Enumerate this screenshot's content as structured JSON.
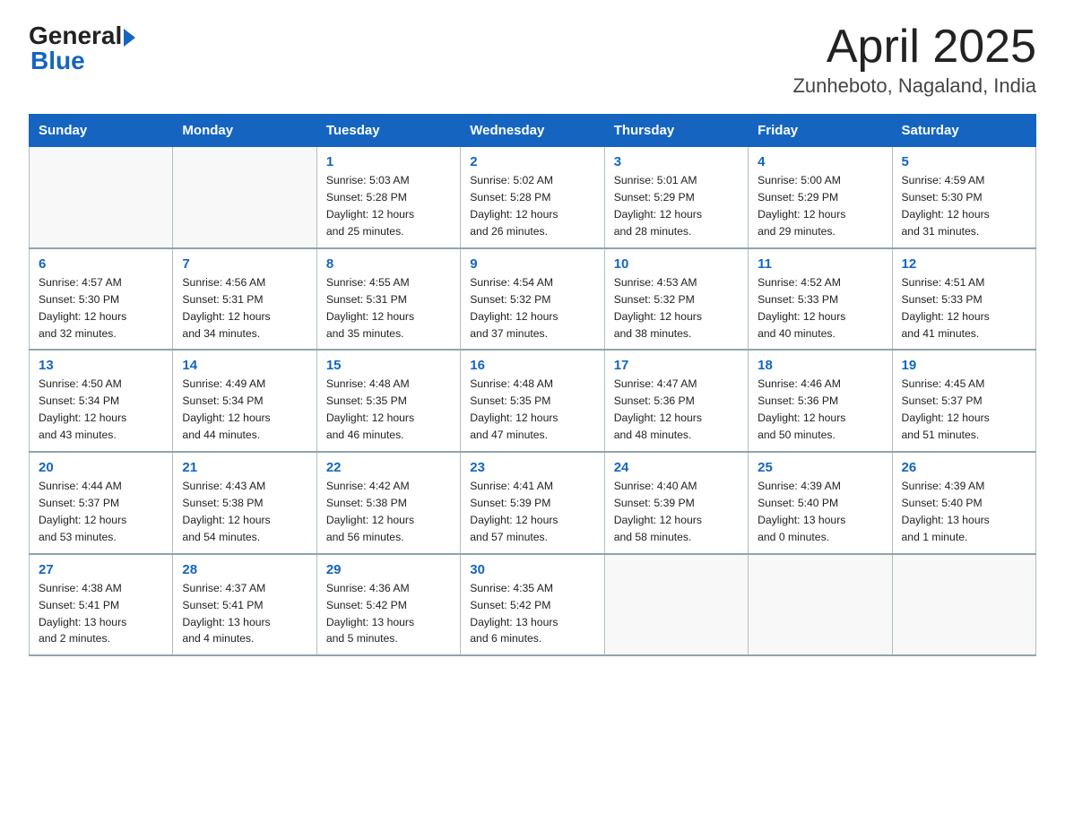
{
  "header": {
    "logo_general": "General",
    "logo_blue": "Blue",
    "month": "April 2025",
    "location": "Zunheboto, Nagaland, India"
  },
  "columns": [
    "Sunday",
    "Monday",
    "Tuesday",
    "Wednesday",
    "Thursday",
    "Friday",
    "Saturday"
  ],
  "weeks": [
    [
      {
        "day": "",
        "info": ""
      },
      {
        "day": "",
        "info": ""
      },
      {
        "day": "1",
        "info": "Sunrise: 5:03 AM\nSunset: 5:28 PM\nDaylight: 12 hours\nand 25 minutes."
      },
      {
        "day": "2",
        "info": "Sunrise: 5:02 AM\nSunset: 5:28 PM\nDaylight: 12 hours\nand 26 minutes."
      },
      {
        "day": "3",
        "info": "Sunrise: 5:01 AM\nSunset: 5:29 PM\nDaylight: 12 hours\nand 28 minutes."
      },
      {
        "day": "4",
        "info": "Sunrise: 5:00 AM\nSunset: 5:29 PM\nDaylight: 12 hours\nand 29 minutes."
      },
      {
        "day": "5",
        "info": "Sunrise: 4:59 AM\nSunset: 5:30 PM\nDaylight: 12 hours\nand 31 minutes."
      }
    ],
    [
      {
        "day": "6",
        "info": "Sunrise: 4:57 AM\nSunset: 5:30 PM\nDaylight: 12 hours\nand 32 minutes."
      },
      {
        "day": "7",
        "info": "Sunrise: 4:56 AM\nSunset: 5:31 PM\nDaylight: 12 hours\nand 34 minutes."
      },
      {
        "day": "8",
        "info": "Sunrise: 4:55 AM\nSunset: 5:31 PM\nDaylight: 12 hours\nand 35 minutes."
      },
      {
        "day": "9",
        "info": "Sunrise: 4:54 AM\nSunset: 5:32 PM\nDaylight: 12 hours\nand 37 minutes."
      },
      {
        "day": "10",
        "info": "Sunrise: 4:53 AM\nSunset: 5:32 PM\nDaylight: 12 hours\nand 38 minutes."
      },
      {
        "day": "11",
        "info": "Sunrise: 4:52 AM\nSunset: 5:33 PM\nDaylight: 12 hours\nand 40 minutes."
      },
      {
        "day": "12",
        "info": "Sunrise: 4:51 AM\nSunset: 5:33 PM\nDaylight: 12 hours\nand 41 minutes."
      }
    ],
    [
      {
        "day": "13",
        "info": "Sunrise: 4:50 AM\nSunset: 5:34 PM\nDaylight: 12 hours\nand 43 minutes."
      },
      {
        "day": "14",
        "info": "Sunrise: 4:49 AM\nSunset: 5:34 PM\nDaylight: 12 hours\nand 44 minutes."
      },
      {
        "day": "15",
        "info": "Sunrise: 4:48 AM\nSunset: 5:35 PM\nDaylight: 12 hours\nand 46 minutes."
      },
      {
        "day": "16",
        "info": "Sunrise: 4:48 AM\nSunset: 5:35 PM\nDaylight: 12 hours\nand 47 minutes."
      },
      {
        "day": "17",
        "info": "Sunrise: 4:47 AM\nSunset: 5:36 PM\nDaylight: 12 hours\nand 48 minutes."
      },
      {
        "day": "18",
        "info": "Sunrise: 4:46 AM\nSunset: 5:36 PM\nDaylight: 12 hours\nand 50 minutes."
      },
      {
        "day": "19",
        "info": "Sunrise: 4:45 AM\nSunset: 5:37 PM\nDaylight: 12 hours\nand 51 minutes."
      }
    ],
    [
      {
        "day": "20",
        "info": "Sunrise: 4:44 AM\nSunset: 5:37 PM\nDaylight: 12 hours\nand 53 minutes."
      },
      {
        "day": "21",
        "info": "Sunrise: 4:43 AM\nSunset: 5:38 PM\nDaylight: 12 hours\nand 54 minutes."
      },
      {
        "day": "22",
        "info": "Sunrise: 4:42 AM\nSunset: 5:38 PM\nDaylight: 12 hours\nand 56 minutes."
      },
      {
        "day": "23",
        "info": "Sunrise: 4:41 AM\nSunset: 5:39 PM\nDaylight: 12 hours\nand 57 minutes."
      },
      {
        "day": "24",
        "info": "Sunrise: 4:40 AM\nSunset: 5:39 PM\nDaylight: 12 hours\nand 58 minutes."
      },
      {
        "day": "25",
        "info": "Sunrise: 4:39 AM\nSunset: 5:40 PM\nDaylight: 13 hours\nand 0 minutes."
      },
      {
        "day": "26",
        "info": "Sunrise: 4:39 AM\nSunset: 5:40 PM\nDaylight: 13 hours\nand 1 minute."
      }
    ],
    [
      {
        "day": "27",
        "info": "Sunrise: 4:38 AM\nSunset: 5:41 PM\nDaylight: 13 hours\nand 2 minutes."
      },
      {
        "day": "28",
        "info": "Sunrise: 4:37 AM\nSunset: 5:41 PM\nDaylight: 13 hours\nand 4 minutes."
      },
      {
        "day": "29",
        "info": "Sunrise: 4:36 AM\nSunset: 5:42 PM\nDaylight: 13 hours\nand 5 minutes."
      },
      {
        "day": "30",
        "info": "Sunrise: 4:35 AM\nSunset: 5:42 PM\nDaylight: 13 hours\nand 6 minutes."
      },
      {
        "day": "",
        "info": ""
      },
      {
        "day": "",
        "info": ""
      },
      {
        "day": "",
        "info": ""
      }
    ]
  ]
}
